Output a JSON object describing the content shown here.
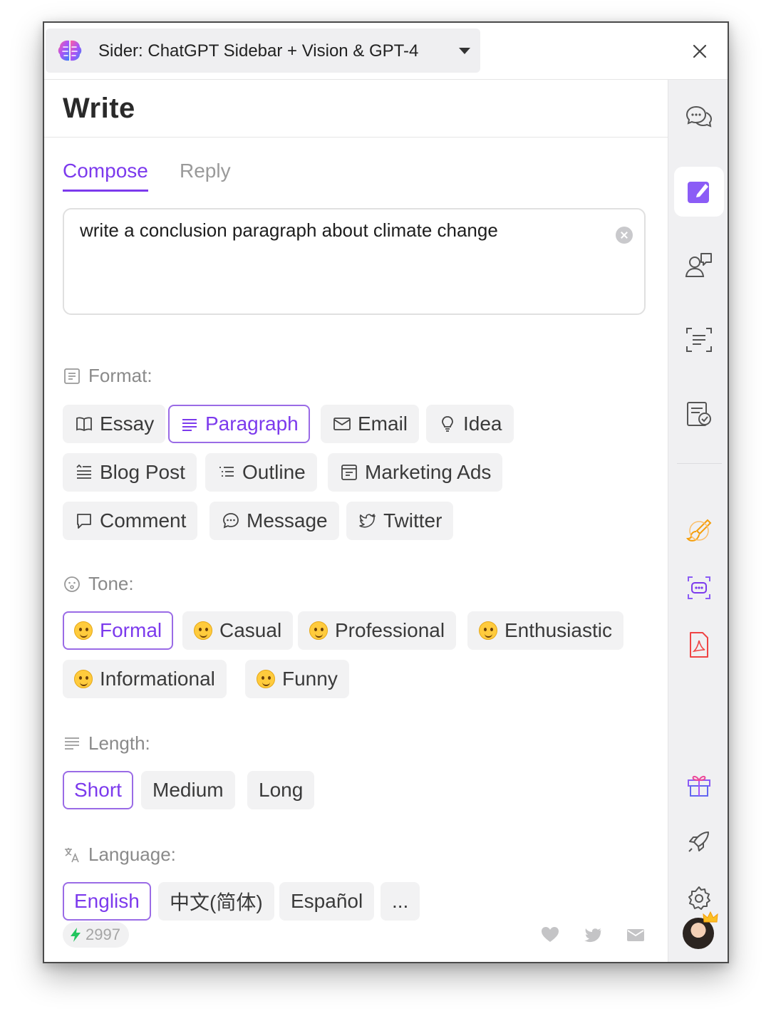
{
  "window": {
    "title": "Sider: ChatGPT Sidebar + Vision & GPT-4"
  },
  "page": {
    "title": "Write"
  },
  "tabs": [
    {
      "label": "Compose",
      "selected": true
    },
    {
      "label": "Reply",
      "selected": false
    }
  ],
  "prompt": {
    "value": "write a conclusion paragraph about climate change"
  },
  "format": {
    "label": "Format:",
    "options": [
      {
        "label": "Essay",
        "icon": "book-icon",
        "selected": false
      },
      {
        "label": "Paragraph",
        "icon": "paragraph-icon",
        "selected": true
      },
      {
        "label": "Email",
        "icon": "mail-icon",
        "selected": false
      },
      {
        "label": "Idea",
        "icon": "lightbulb-icon",
        "selected": false
      },
      {
        "label": "Blog Post",
        "icon": "blog-icon",
        "selected": false
      },
      {
        "label": "Outline",
        "icon": "list-icon",
        "selected": false
      },
      {
        "label": "Marketing Ads",
        "icon": "ad-icon",
        "selected": false
      },
      {
        "label": "Comment",
        "icon": "comment-icon",
        "selected": false
      },
      {
        "label": "Message",
        "icon": "message-icon",
        "selected": false
      },
      {
        "label": "Twitter",
        "icon": "twitter-icon",
        "selected": false
      }
    ]
  },
  "tone": {
    "label": "Tone:",
    "options": [
      {
        "label": "Formal",
        "icon": "slight-smile-emoji",
        "selected": true
      },
      {
        "label": "Casual",
        "icon": "wink-emoji",
        "selected": false
      },
      {
        "label": "Professional",
        "icon": "monocle-emoji",
        "selected": false
      },
      {
        "label": "Enthusiastic",
        "icon": "star-eyes-emoji",
        "selected": false
      },
      {
        "label": "Informational",
        "icon": "nerd-emoji",
        "selected": false
      },
      {
        "label": "Funny",
        "icon": "grin-emoji",
        "selected": false
      }
    ]
  },
  "length": {
    "label": "Length:",
    "options": [
      {
        "label": "Short",
        "selected": true
      },
      {
        "label": "Medium",
        "selected": false
      },
      {
        "label": "Long",
        "selected": false
      }
    ]
  },
  "language": {
    "label": "Language:",
    "options": [
      {
        "label": "English",
        "selected": true
      },
      {
        "label": "中文(简体)",
        "selected": false
      },
      {
        "label": "Español",
        "selected": false
      },
      {
        "label": "...",
        "selected": false
      }
    ]
  },
  "footer": {
    "credits": "2997",
    "icons": [
      "heart-icon",
      "twitter-icon",
      "mail-icon"
    ]
  },
  "rail": {
    "items": [
      "chat-icon",
      "write-icon",
      "agent-icon",
      "ocr-icon",
      "grammar-icon",
      "paint-icon",
      "bot-icon",
      "pdf-icon",
      "gift-icon",
      "rocket-icon",
      "settings-icon",
      "avatar"
    ],
    "active": "write-icon"
  },
  "colors": {
    "accent": "#7c3aed",
    "chip_bg": "#f2f2f3",
    "rail_bg": "#f0f0f2",
    "credits_bolt": "#22c55e"
  }
}
